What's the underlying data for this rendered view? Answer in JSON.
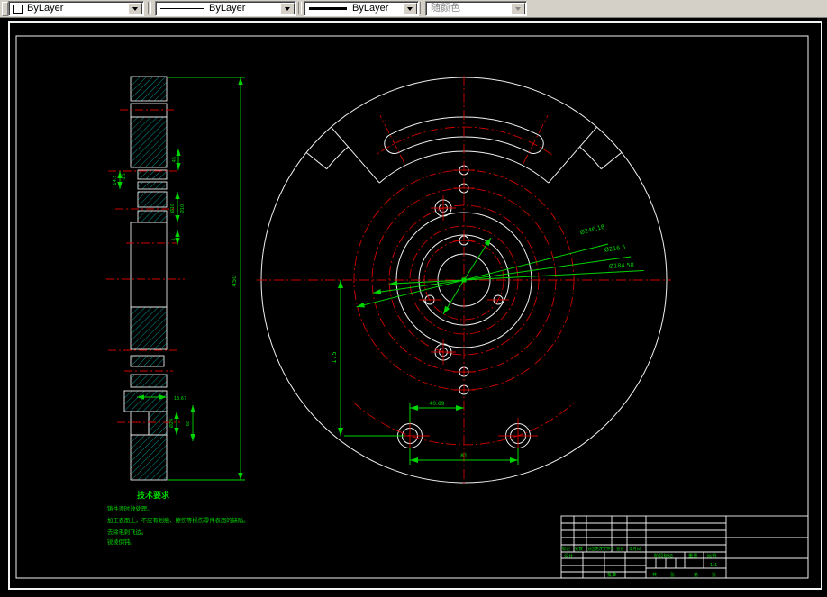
{
  "toolbar": {
    "color_control": {
      "value": "ByLayer"
    },
    "linetype_control": {
      "value": "ByLayer"
    },
    "lineweight_control": {
      "value": "ByLayer"
    },
    "plotstyle_control": {
      "value": "随颜色"
    }
  },
  "colors": {
    "background": "#000000",
    "line_white": "#f2f2f2",
    "centerline_red": "#cf0000",
    "dimension_green": "#00d400",
    "hatch_cyan": "#00b8b8",
    "toolbar_face": "#d4d0c8"
  },
  "drawing": {
    "tech_requirements": {
      "title": "技术要求",
      "lines": [
        "铸件须时效处理。",
        "加工表面上，不应有划痕、擦伤等损伤零件表面的缺陷。",
        "去除毛刺飞边。",
        "锐棱倒钝。"
      ]
    },
    "front_view": {
      "leaders": [
        {
          "label": "Ø246.18"
        },
        {
          "label": "Ø216.5"
        },
        {
          "label": "Ø184.58"
        }
      ],
      "dims": {
        "v175": "175",
        "h4089": "40.89",
        "h81": "81"
      }
    },
    "section_view": {
      "dims": {
        "overall": "450",
        "d1367": "13.67",
        "d24": "Ø24",
        "d68": "68",
        "d145": "14.5",
        "d45a": "4.5",
        "d45": "45",
        "d16": "Ø16",
        "d10": "Ø10",
        "d4": "4"
      }
    },
    "title_block": {
      "revision_row": [
        "标记",
        "处数",
        "分区",
        "更改文件号",
        "签名",
        "年月日"
      ],
      "roles": [
        "设计",
        "批准"
      ],
      "stage_label": "阶段标记",
      "weight_label": "重量",
      "scale_label": "比例",
      "scale_value": "1:1",
      "sheet_info": [
        "共",
        "张",
        "第",
        "张"
      ]
    }
  }
}
